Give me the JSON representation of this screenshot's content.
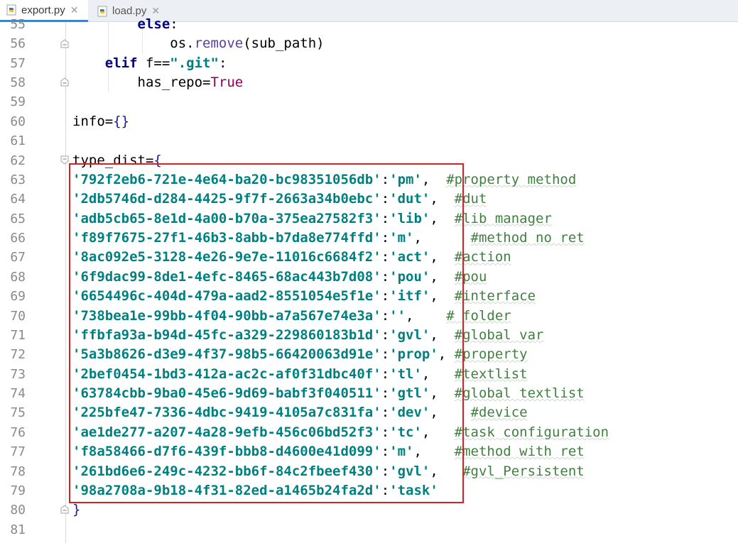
{
  "tabs": [
    {
      "label": "export.py",
      "close": "✕",
      "active": true
    },
    {
      "label": "load.py",
      "close": "✕",
      "active": false
    }
  ],
  "lines": [
    {
      "no": "55",
      "tokens": [
        {
          "t": "        ",
          "c": "pl"
        },
        {
          "t": "else",
          "c": "kw"
        },
        {
          "t": ":",
          "c": "pl"
        }
      ]
    },
    {
      "no": "56",
      "tokens": [
        {
          "t": "            os.",
          "c": "pl"
        },
        {
          "t": "remove",
          "c": "fn"
        },
        {
          "t": "(sub_path)",
          "c": "pl"
        }
      ]
    },
    {
      "no": "57",
      "tokens": [
        {
          "t": "    ",
          "c": "pl"
        },
        {
          "t": "elif",
          "c": "kw"
        },
        {
          "t": " f==",
          "c": "pl"
        },
        {
          "t": "\".git\"",
          "c": "str"
        },
        {
          "t": ":",
          "c": "pl"
        }
      ]
    },
    {
      "no": "58",
      "tokens": [
        {
          "t": "        has_repo=",
          "c": "pl"
        },
        {
          "t": "True",
          "c": "tru"
        }
      ]
    },
    {
      "no": "59",
      "tokens": []
    },
    {
      "no": "60",
      "tokens": [
        {
          "t": "info=",
          "c": "pl"
        },
        {
          "t": "{}",
          "c": "brk"
        }
      ]
    },
    {
      "no": "61",
      "tokens": []
    },
    {
      "no": "62",
      "tokens": [
        {
          "t": "type_dist=",
          "c": "pl"
        },
        {
          "t": "{",
          "c": "brk"
        }
      ]
    },
    {
      "no": "63",
      "tokens": [
        {
          "t": "'792f2eb6-721e-4e64-ba20-bc98351056db'",
          "c": "str"
        },
        {
          "t": ":",
          "c": "pl"
        },
        {
          "t": "'pm'",
          "c": "str"
        },
        {
          "t": ",  ",
          "c": "pl"
        },
        {
          "t": "#property method",
          "c": "cm"
        }
      ]
    },
    {
      "no": "64",
      "tokens": [
        {
          "t": "'2db5746d-d284-4425-9f7f-2663a34b0ebc'",
          "c": "str"
        },
        {
          "t": ":",
          "c": "pl"
        },
        {
          "t": "'dut'",
          "c": "str"
        },
        {
          "t": ",  ",
          "c": "pl"
        },
        {
          "t": "#dut",
          "c": "cm"
        }
      ]
    },
    {
      "no": "65",
      "tokens": [
        {
          "t": "'adb5cb65-8e1d-4a00-b70a-375ea27582f3'",
          "c": "str"
        },
        {
          "t": ":",
          "c": "pl"
        },
        {
          "t": "'lib'",
          "c": "str"
        },
        {
          "t": ",  ",
          "c": "pl"
        },
        {
          "t": "#lib manager",
          "c": "cm"
        }
      ]
    },
    {
      "no": "66",
      "tokens": [
        {
          "t": "'f89f7675-27f1-46b3-8abb-b7da8e774ffd'",
          "c": "str"
        },
        {
          "t": ":",
          "c": "pl"
        },
        {
          "t": "'m'",
          "c": "str"
        },
        {
          "t": ",      ",
          "c": "pl"
        },
        {
          "t": "#method no ret",
          "c": "cm"
        }
      ]
    },
    {
      "no": "67",
      "tokens": [
        {
          "t": "'8ac092e5-3128-4e26-9e7e-11016c6684f2'",
          "c": "str"
        },
        {
          "t": ":",
          "c": "pl"
        },
        {
          "t": "'act'",
          "c": "str"
        },
        {
          "t": ",  ",
          "c": "pl"
        },
        {
          "t": "#action",
          "c": "cm"
        }
      ]
    },
    {
      "no": "68",
      "tokens": [
        {
          "t": "'6f9dac99-8de1-4efc-8465-68ac443b7d08'",
          "c": "str"
        },
        {
          "t": ":",
          "c": "pl"
        },
        {
          "t": "'pou'",
          "c": "str"
        },
        {
          "t": ",  ",
          "c": "pl"
        },
        {
          "t": "#pou",
          "c": "cm"
        }
      ]
    },
    {
      "no": "69",
      "tokens": [
        {
          "t": "'6654496c-404d-479a-aad2-8551054e5f1e'",
          "c": "str"
        },
        {
          "t": ":",
          "c": "pl"
        },
        {
          "t": "'itf'",
          "c": "str"
        },
        {
          "t": ",  ",
          "c": "pl"
        },
        {
          "t": "#interface",
          "c": "cm"
        }
      ]
    },
    {
      "no": "70",
      "tokens": [
        {
          "t": "'738bea1e-99bb-4f04-90bb-a7a567e74e3a'",
          "c": "str"
        },
        {
          "t": ":",
          "c": "pl"
        },
        {
          "t": "''",
          "c": "str"
        },
        {
          "t": ",    ",
          "c": "pl"
        },
        {
          "t": "# folder",
          "c": "cm"
        }
      ]
    },
    {
      "no": "71",
      "tokens": [
        {
          "t": "'ffbfa93a-b94d-45fc-a329-229860183b1d'",
          "c": "str"
        },
        {
          "t": ":",
          "c": "pl"
        },
        {
          "t": "'gvl'",
          "c": "str"
        },
        {
          "t": ",  ",
          "c": "pl"
        },
        {
          "t": "#global var",
          "c": "cm"
        }
      ]
    },
    {
      "no": "72",
      "tokens": [
        {
          "t": "'5a3b8626-d3e9-4f37-98b5-66420063d91e'",
          "c": "str"
        },
        {
          "t": ":",
          "c": "pl"
        },
        {
          "t": "'prop'",
          "c": "str"
        },
        {
          "t": ", ",
          "c": "pl"
        },
        {
          "t": "#property",
          "c": "cm"
        }
      ]
    },
    {
      "no": "73",
      "tokens": [
        {
          "t": "'2bef0454-1bd3-412a-ac2c-af0f31dbc40f'",
          "c": "str"
        },
        {
          "t": ":",
          "c": "pl"
        },
        {
          "t": "'tl'",
          "c": "str"
        },
        {
          "t": ",   ",
          "c": "pl"
        },
        {
          "t": "#textlist",
          "c": "cm"
        }
      ]
    },
    {
      "no": "74",
      "tokens": [
        {
          "t": "'63784cbb-9ba0-45e6-9d69-babf3f040511'",
          "c": "str"
        },
        {
          "t": ":",
          "c": "pl"
        },
        {
          "t": "'gtl'",
          "c": "str"
        },
        {
          "t": ",  ",
          "c": "pl"
        },
        {
          "t": "#global textlist",
          "c": "cm"
        }
      ]
    },
    {
      "no": "75",
      "tokens": [
        {
          "t": "'225bfe47-7336-4dbc-9419-4105a7c831fa'",
          "c": "str"
        },
        {
          "t": ":",
          "c": "pl"
        },
        {
          "t": "'dev'",
          "c": "str"
        },
        {
          "t": ",    ",
          "c": "pl"
        },
        {
          "t": "#device",
          "c": "cm"
        }
      ]
    },
    {
      "no": "76",
      "tokens": [
        {
          "t": "'ae1de277-a207-4a28-9efb-456c06bd52f3'",
          "c": "str"
        },
        {
          "t": ":",
          "c": "pl"
        },
        {
          "t": "'tc'",
          "c": "str"
        },
        {
          "t": ",   ",
          "c": "pl"
        },
        {
          "t": "#task configuration",
          "c": "cm"
        }
      ]
    },
    {
      "no": "77",
      "tokens": [
        {
          "t": "'f8a58466-d7f6-439f-bbb8-d4600e41d099'",
          "c": "str"
        },
        {
          "t": ":",
          "c": "pl"
        },
        {
          "t": "'m'",
          "c": "str"
        },
        {
          "t": ",    ",
          "c": "pl"
        },
        {
          "t": "#method with ret",
          "c": "cm"
        }
      ]
    },
    {
      "no": "78",
      "tokens": [
        {
          "t": "'261bd6e6-249c-4232-bb6f-84c2fbeef430'",
          "c": "str"
        },
        {
          "t": ":",
          "c": "pl"
        },
        {
          "t": "'gvl'",
          "c": "str"
        },
        {
          "t": ",   ",
          "c": "pl"
        },
        {
          "t": "#gvl_Persistent",
          "c": "cm"
        }
      ]
    },
    {
      "no": "79",
      "tokens": [
        {
          "t": "'98a2708a-9b18-4f31-82ed-a1465b24fa2d'",
          "c": "str"
        },
        {
          "t": ":",
          "c": "pl"
        },
        {
          "t": "'task'",
          "c": "str"
        }
      ]
    },
    {
      "no": "80",
      "tokens": [
        {
          "t": "}",
          "c": "brk"
        }
      ]
    },
    {
      "no": "81",
      "tokens": []
    }
  ],
  "colors": {
    "highlight_box": "#d92020",
    "tab_accent": "#4083c9"
  }
}
